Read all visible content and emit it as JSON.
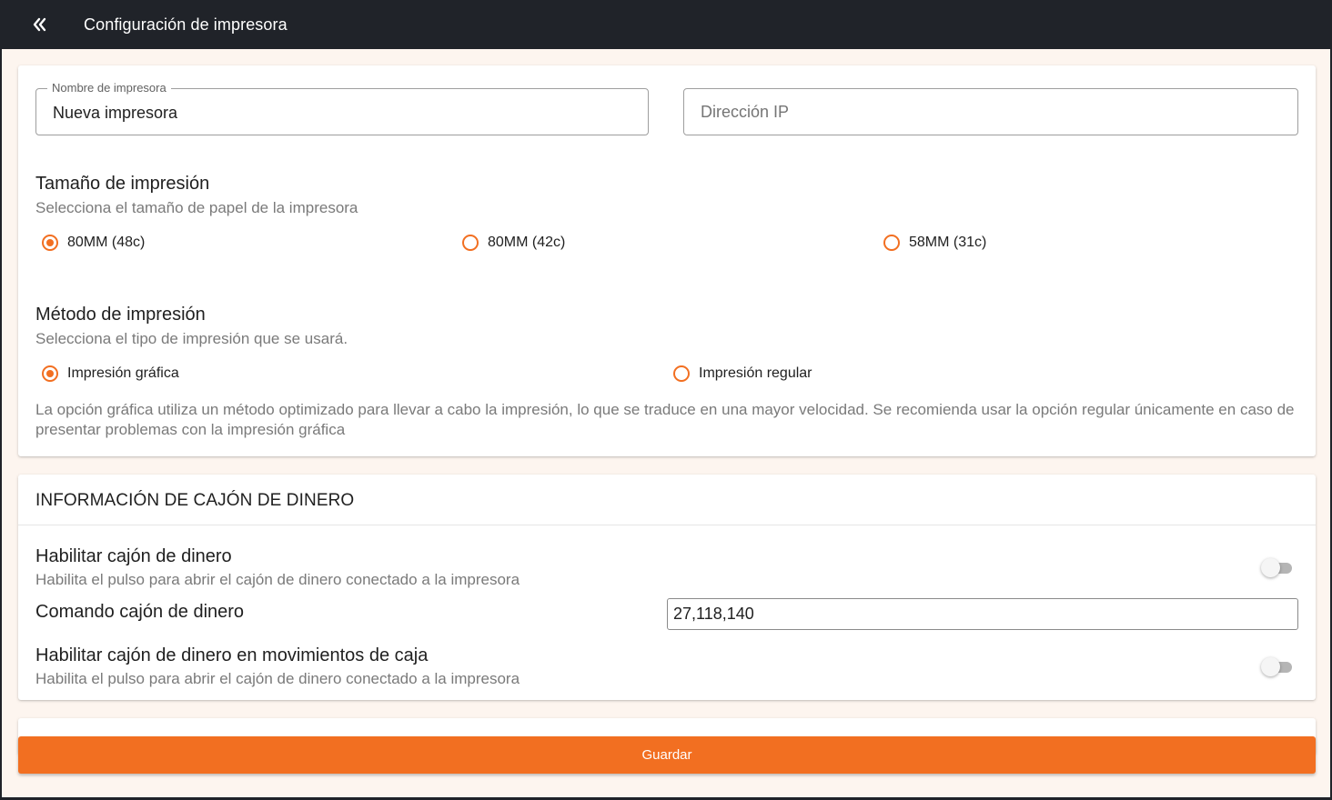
{
  "topbar": {
    "back_icon": "double-chevron-left-icon",
    "title": "Configuración de impresora"
  },
  "printer": {
    "name_label": "Nombre de impresora",
    "name_value": "Nueva impresora",
    "ip_placeholder": "Dirección IP"
  },
  "print_size": {
    "title": "Tamaño de impresión",
    "subtitle": "Selecciona el tamaño de papel de la impresora",
    "options": [
      {
        "label": "80MM (48c)",
        "selected": true
      },
      {
        "label": "80MM (42c)",
        "selected": false
      },
      {
        "label": "58MM (31c)",
        "selected": false
      }
    ]
  },
  "print_method": {
    "title": "Método de impresión",
    "subtitle": "Selecciona el tipo de impresión que se usará.",
    "options": [
      {
        "label": "Impresión gráfica",
        "selected": true
      },
      {
        "label": "Impresión regular",
        "selected": false
      }
    ],
    "note": "La opción gráfica utiliza un método optimizado para llevar a cabo la impresión, lo que se traduce en una mayor velocidad. Se recomienda usar la opción regular únicamente en caso de presentar problemas con la impresión gráfica"
  },
  "cash_drawer": {
    "header": "INFORMACIÓN DE CAJÓN DE DINERO",
    "enable_title": "Habilitar cajón de dinero",
    "enable_sub": "Habilita el pulso para abrir el cajón de dinero conectado a la impresora",
    "enable_on": false,
    "command_label": "Comando cajón de dinero",
    "command_value": "27,118,140",
    "movements_title": "Habilitar cajón de dinero en movimientos de caja",
    "movements_sub": "Habilita el pulso para abrir el cajón de dinero conectado a la impresora",
    "movements_on": false
  },
  "actions": {
    "save_label": "Guardar"
  },
  "colors": {
    "accent": "#f26f21",
    "topbar": "#202329",
    "background": "#fdf5ef"
  }
}
